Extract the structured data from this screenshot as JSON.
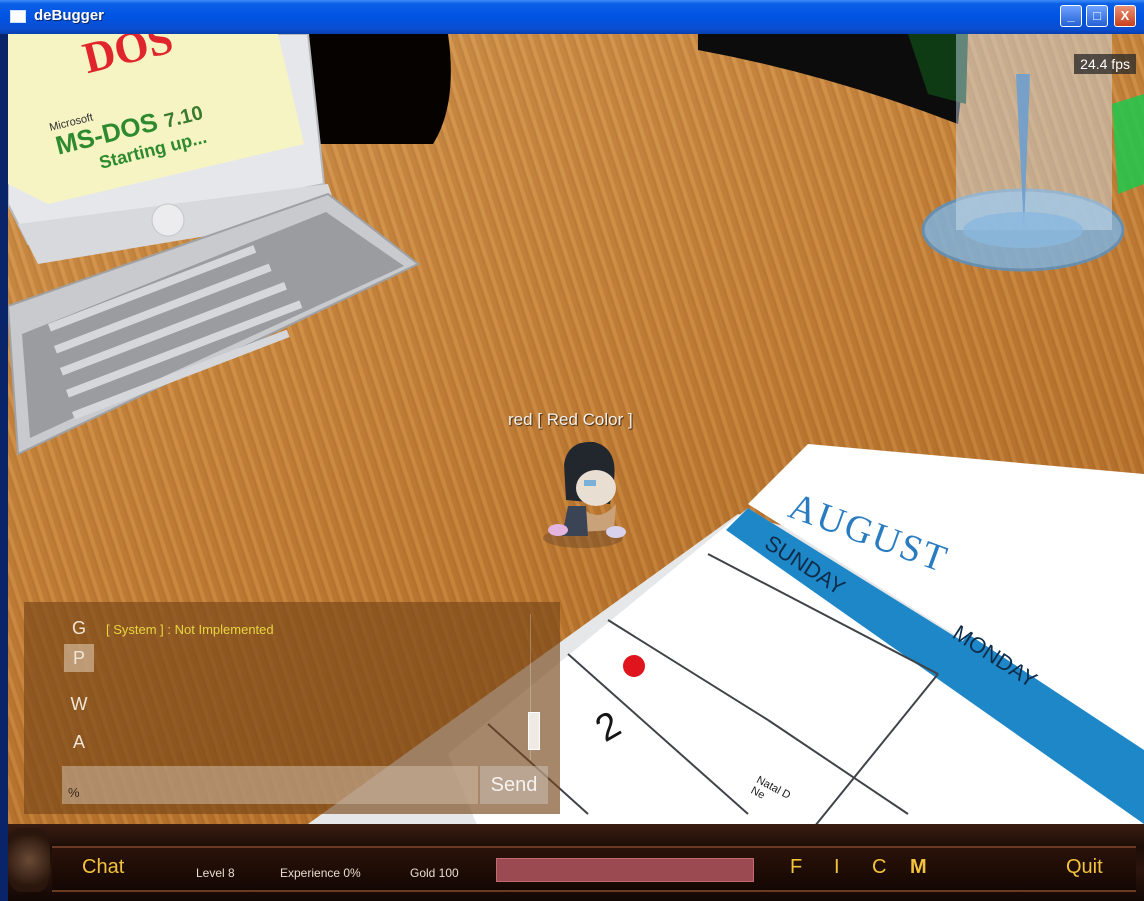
{
  "window": {
    "title": "deBugger",
    "buttons": {
      "minimize": "_",
      "maximize": "□",
      "close": "X"
    }
  },
  "hud": {
    "fps": "24.4 fps"
  },
  "scene": {
    "monitor_screen": {
      "logo_text": "DOS",
      "brand": "Microsoft",
      "product": "MS-DOS",
      "version": "7.10",
      "status": "Starting up..."
    },
    "calendar": {
      "month": "AUGUST",
      "day_headers": [
        "SUNDAY",
        "MONDAY"
      ],
      "day_number": "2",
      "note_line1": "Natal D",
      "note_line2": "Ne"
    }
  },
  "player": {
    "name_tag": "red [ Red Color ]"
  },
  "chat": {
    "channels": [
      "G",
      "P",
      "W",
      "A"
    ],
    "active_channel": "P",
    "message": "[ System ] : Not Implemented",
    "input_value": "%",
    "send_label": "Send"
  },
  "bottom_bar": {
    "chat_label": "Chat",
    "level": "Level 8",
    "experience": "Experience 0%",
    "gold": "Gold 100",
    "menu": [
      "F",
      "I",
      "C",
      "M"
    ],
    "quit_label": "Quit"
  },
  "colors": {
    "title_bar": "#0054e3",
    "wood": "#c98840",
    "gold_text": "#f2c33c",
    "system_message": "#e8d640",
    "calendar_blue": "#1e87c8",
    "exp_bar": "#9a4a50"
  },
  "icons": [
    "window-icon",
    "minimize-icon",
    "maximize-icon",
    "close-icon",
    "ornament-icon"
  ]
}
